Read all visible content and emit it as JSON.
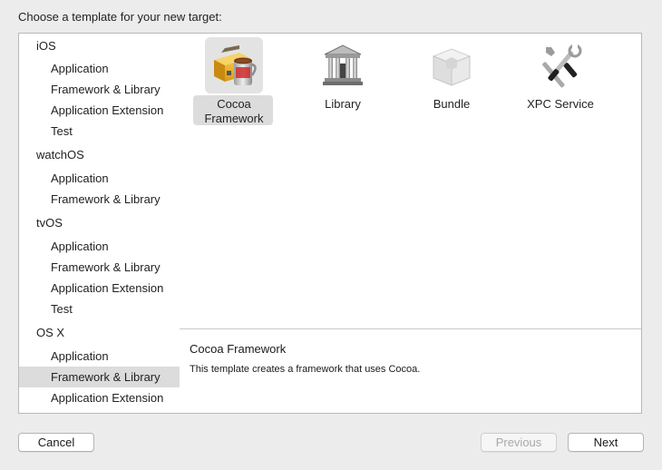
{
  "dialog": {
    "prompt": "Choose a template for your new target:"
  },
  "sidebar": {
    "sections": [
      {
        "label": "iOS",
        "items": [
          "Application",
          "Framework & Library",
          "Application Extension",
          "Test"
        ]
      },
      {
        "label": "watchOS",
        "items": [
          "Application",
          "Framework & Library"
        ]
      },
      {
        "label": "tvOS",
        "items": [
          "Application",
          "Framework & Library",
          "Application Extension",
          "Test"
        ]
      },
      {
        "label": "OS X",
        "items": [
          "Application",
          "Framework & Library",
          "Application Extension"
        ]
      }
    ],
    "selected": "OS X / Framework & Library"
  },
  "templates": [
    {
      "label": "Cocoa Framework",
      "line1": "Cocoa",
      "line2": "Framework",
      "icon": "toolbox-icon",
      "selected": true
    },
    {
      "label": "Library",
      "icon": "library-building-icon",
      "selected": false
    },
    {
      "label": "Bundle",
      "icon": "bundle-box-icon",
      "selected": false
    },
    {
      "label": "XPC Service",
      "icon": "tools-icon",
      "selected": false
    }
  ],
  "detail": {
    "title": "Cocoa Framework",
    "description": "This template creates a framework that uses Cocoa."
  },
  "buttons": {
    "cancel": "Cancel",
    "previous": "Previous",
    "next": "Next"
  }
}
